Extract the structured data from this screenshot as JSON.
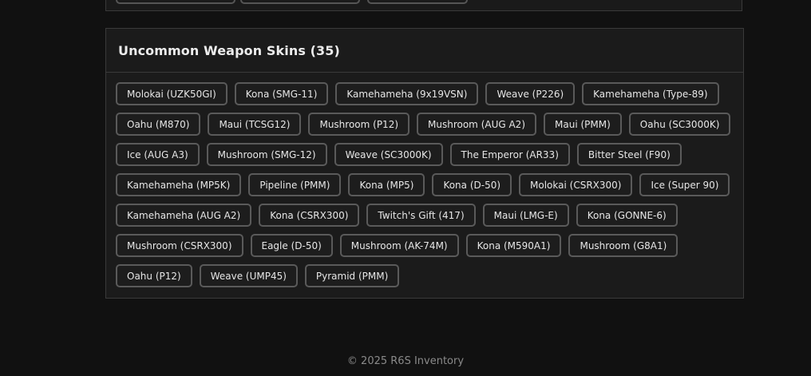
{
  "section": {
    "title": "Uncommon Weapon Skins (35)"
  },
  "skins": [
    "Molokai (UZK50GI)",
    "Kona (SMG-11)",
    "Kamehameha (9x19VSN)",
    "Weave (P226)",
    "Kamehameha (Type-89)",
    "Oahu (M870)",
    "Maui (TCSG12)",
    "Mushroom (P12)",
    "Mushroom (AUG A2)",
    "Maui (PMM)",
    "Oahu (SC3000K)",
    "Ice (AUG A3)",
    "Mushroom (SMG-12)",
    "Weave (SC3000K)",
    "The Emperor (AR33)",
    "Bitter Steel (F90)",
    "Kamehameha (MP5K)",
    "Pipeline (PMM)",
    "Kona (MP5)",
    "Kona (D-50)",
    "Molokai (CSRX300)",
    "Ice (Super 90)",
    "Kamehameha (AUG A2)",
    "Kona (CSRX300)",
    "Twitch's Gift (417)",
    "Maui (LMG-E)",
    "Kona (GONNE-6)",
    "Mushroom (CSRX300)",
    "Eagle (D-50)",
    "Mushroom (AK-74M)",
    "Kona (M590A1)",
    "Mushroom (G8A1)",
    "Oahu (P12)",
    "Weave (UMP45)",
    "Pyramid (PMM)"
  ],
  "footer": {
    "text": "© 2025 R6S Inventory"
  }
}
